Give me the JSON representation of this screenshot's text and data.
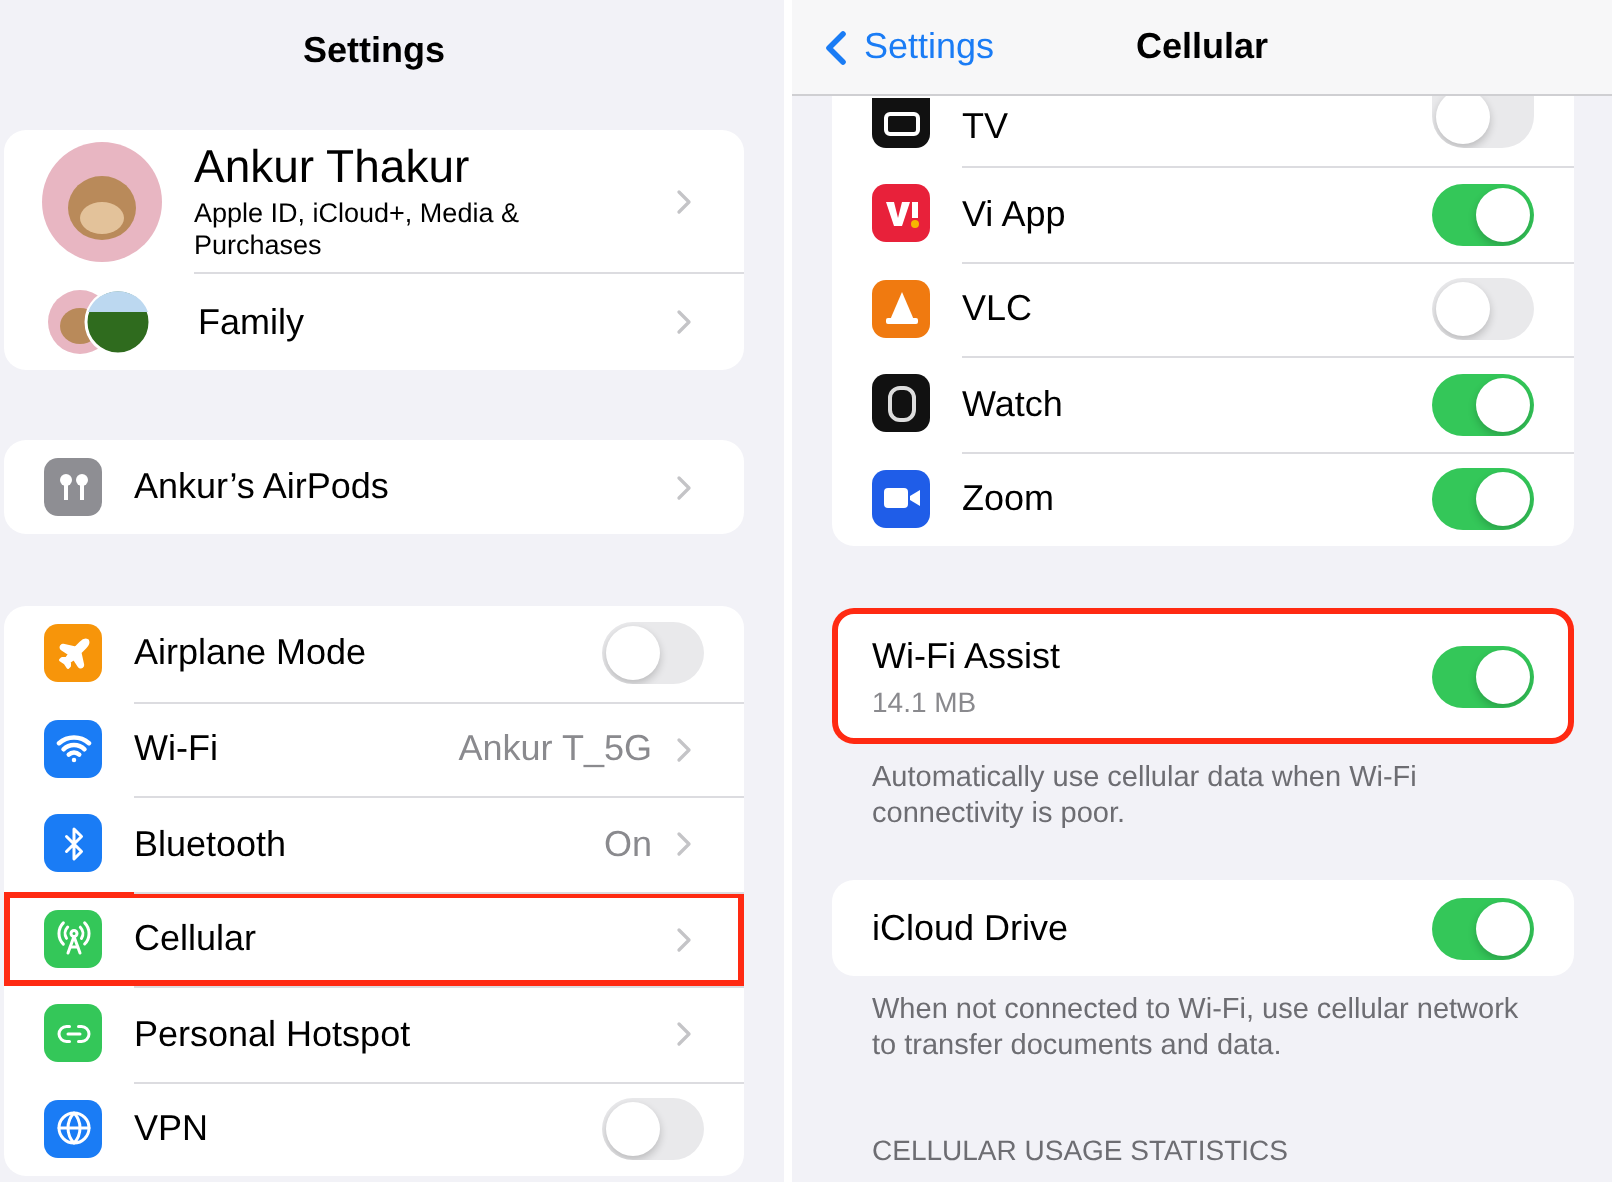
{
  "settings": {
    "title": "Settings",
    "profile": {
      "name": "Ankur Thakur",
      "subtitle": "Apple ID, iCloud+, Media & Purchases"
    },
    "family": {
      "label": "Family"
    },
    "devices": [
      {
        "label": "Ankur’s AirPods"
      }
    ],
    "rows": [
      {
        "label": "Airplane Mode",
        "kind": "toggle",
        "on": false,
        "highlighted": false
      },
      {
        "label": "Wi-Fi",
        "kind": "link",
        "value": "Ankur T_5G",
        "highlighted": false
      },
      {
        "label": "Bluetooth",
        "kind": "link",
        "value": "On",
        "highlighted": false
      },
      {
        "label": "Cellular",
        "kind": "link",
        "highlighted": true
      },
      {
        "label": "Personal Hotspot",
        "kind": "link",
        "highlighted": false
      },
      {
        "label": "VPN",
        "kind": "toggle",
        "on": false,
        "highlighted": false
      }
    ]
  },
  "cellular": {
    "nav": {
      "back": "Settings",
      "title": "Cellular"
    },
    "apps": [
      {
        "label": "TV",
        "on": false
      },
      {
        "label": "Vi App",
        "on": true
      },
      {
        "label": "VLC",
        "on": false
      },
      {
        "label": "Watch",
        "on": true
      },
      {
        "label": "Zoom",
        "on": true
      }
    ],
    "wifi_assist": {
      "label": "Wi-Fi Assist",
      "usage": "14.1 MB",
      "on": true,
      "highlighted": true,
      "footer": "Automatically use cellular data when Wi-Fi connectivity is poor."
    },
    "icloud": {
      "label": "iCloud Drive",
      "on": true,
      "footer": "When not connected to Wi-Fi, use cellular network to transfer documents and data."
    },
    "section_header": "CELLULAR USAGE STATISTICS"
  }
}
